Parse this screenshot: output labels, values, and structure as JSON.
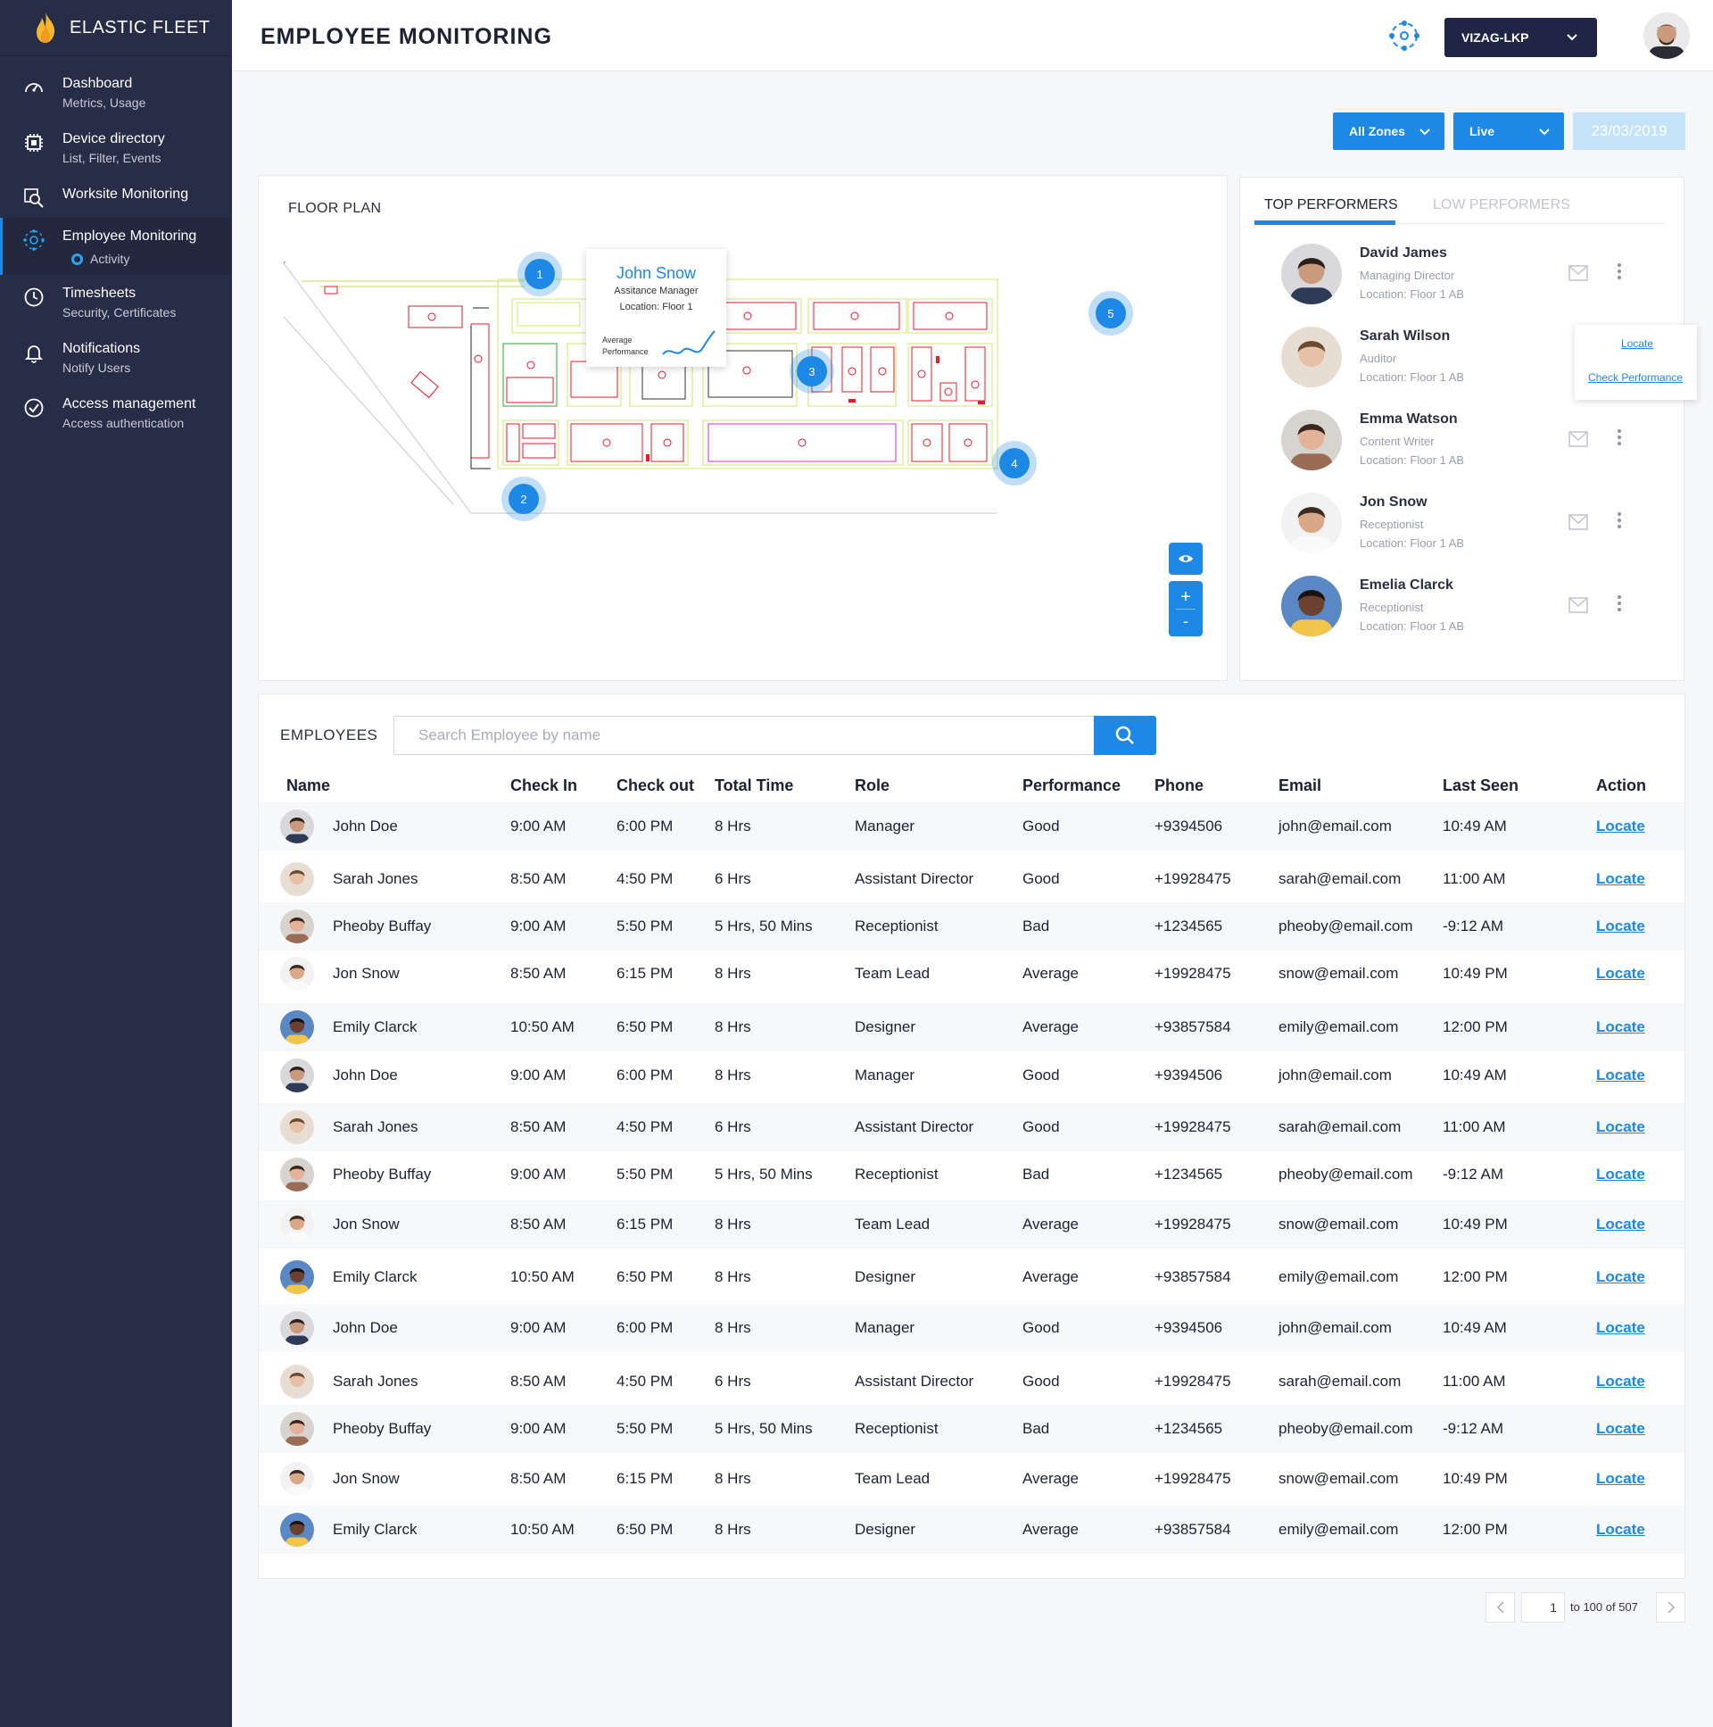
{
  "app": {
    "name": "ELASTIC FLEET"
  },
  "sidebar": {
    "items": [
      {
        "title": "Dashboard",
        "subtitle": "Metrics, Usage",
        "icon": "gauge-icon"
      },
      {
        "title": "Device directory",
        "subtitle": "List, Filter, Events",
        "icon": "chip-icon"
      },
      {
        "title": "Worksite Monitoring",
        "subtitle": "",
        "icon": "search-map-icon"
      },
      {
        "title": "Employee Monitoring",
        "subtitle": "",
        "icon": "network-icon",
        "active": true,
        "child": "Activity"
      },
      {
        "title": "Timesheets",
        "subtitle": "Security, Certificates",
        "icon": "clock-icon"
      },
      {
        "title": "Notifications",
        "subtitle": "Notify Users",
        "icon": "bell-icon"
      },
      {
        "title": "Access management",
        "subtitle": "Access authentication",
        "icon": "check-circle-icon"
      }
    ]
  },
  "header": {
    "title": "EMPLOYEE MONITORING",
    "site": "VIZAG-LKP"
  },
  "filters": {
    "zone": "All Zones",
    "mode": "Live",
    "date": "23/03/2019"
  },
  "floorplan": {
    "title": "FLOOR PLAN",
    "pins": [
      "1",
      "2",
      "3",
      "4",
      "5"
    ],
    "tooltip": {
      "name": "John Snow",
      "role": "Assitance Manager",
      "location": "Location: Floor 1",
      "metric_line1": "Average",
      "metric_line2": "Performance"
    },
    "controls": {
      "plus": "+",
      "minus": "-"
    }
  },
  "performers": {
    "tabs": [
      "TOP PERFORMERS",
      "LOW PERFORMERS"
    ],
    "items": [
      {
        "name": "David James",
        "role": "Managing Director",
        "location": "Location: Floor 1 AB"
      },
      {
        "name": "Sarah Wilson",
        "role": "Auditor",
        "location": "Location: Floor 1 AB"
      },
      {
        "name": "Emma Watson",
        "role": "Content Writer",
        "location": "Location: Floor 1 AB"
      },
      {
        "name": "Jon Snow",
        "role": "Receptionist",
        "location": "Location: Floor 1 AB"
      },
      {
        "name": "Emelia Clarck",
        "role": "Receptionist",
        "location": "Location: Floor 1 AB"
      }
    ],
    "menu": {
      "locate": "Locate",
      "check": "Check Performance"
    }
  },
  "employees": {
    "title": "EMPLOYEES",
    "search_placeholder": "Search Employee by name",
    "columns": [
      "Name",
      "Check In",
      "Check out",
      "Total Time",
      "Role",
      "Performance",
      "Phone",
      "Email",
      "Last Seen",
      "Action"
    ],
    "rows": [
      [
        "John Doe",
        "9:00 AM",
        "6:00 PM",
        "8 Hrs",
        "Manager",
        "Good",
        "+9394506",
        "john@email.com",
        "10:49 AM",
        "Locate"
      ],
      [
        "Sarah Jones",
        "8:50 AM",
        "4:50 PM",
        "6 Hrs",
        "Assistant Director",
        "Good",
        "+19928475",
        "sarah@email.com",
        "11:00 AM",
        "Locate"
      ],
      [
        "Pheoby Buffay",
        "9:00 AM",
        "5:50 PM",
        "5 Hrs, 50 Mins",
        "Receptionist",
        "Bad",
        "+1234565",
        "pheoby@email.com",
        "-9:12 AM",
        "Locate"
      ],
      [
        "Jon Snow",
        "8:50 AM",
        "6:15 PM",
        "8 Hrs",
        "Team Lead",
        "Average",
        "+19928475",
        "snow@email.com",
        "10:49 PM",
        "Locate"
      ],
      [
        "Emily Clarck",
        "10:50 AM",
        "6:50 PM",
        "8 Hrs",
        "Designer",
        "Average",
        "+93857584",
        "emily@email.com",
        "12:00  PM",
        "Locate"
      ],
      [
        "John Doe",
        "9:00 AM",
        "6:00 PM",
        "8 Hrs",
        "Manager",
        "Good",
        "+9394506",
        "john@email.com",
        "10:49 AM",
        "Locate"
      ],
      [
        "Sarah Jones",
        "8:50 AM",
        "4:50 PM",
        "6 Hrs",
        "Assistant Director",
        "Good",
        "+19928475",
        "sarah@email.com",
        "11:00 AM",
        "Locate"
      ],
      [
        "Pheoby Buffay",
        "9:00 AM",
        "5:50 PM",
        "5 Hrs, 50 Mins",
        "Receptionist",
        "Bad",
        "+1234565",
        "pheoby@email.com",
        "-9:12 AM",
        "Locate"
      ],
      [
        "Jon Snow",
        "8:50 AM",
        "6:15 PM",
        "8 Hrs",
        "Team Lead",
        "Average",
        "+19928475",
        "snow@email.com",
        "10:49 PM",
        "Locate"
      ],
      [
        "Emily Clarck",
        "10:50 AM",
        "6:50 PM",
        "8 Hrs",
        "Designer",
        "Average",
        "+93857584",
        "emily@email.com",
        "12:00  PM",
        "Locate"
      ],
      [
        "John Doe",
        "9:00 AM",
        "6:00 PM",
        "8 Hrs",
        "Manager",
        "Good",
        "+9394506",
        "john@email.com",
        "10:49 AM",
        "Locate"
      ],
      [
        "Sarah Jones",
        "8:50 AM",
        "4:50 PM",
        "6 Hrs",
        "Assistant Director",
        "Good",
        "+19928475",
        "sarah@email.com",
        "11:00 AM",
        "Locate"
      ],
      [
        "Pheoby Buffay",
        "9:00 AM",
        "5:50 PM",
        "5 Hrs, 50 Mins",
        "Receptionist",
        "Bad",
        "+1234565",
        "pheoby@email.com",
        "-9:12 AM",
        "Locate"
      ],
      [
        "Jon Snow",
        "8:50 AM",
        "6:15 PM",
        "8 Hrs",
        "Team Lead",
        "Average",
        "+19928475",
        "snow@email.com",
        "10:49 PM",
        "Locate"
      ],
      [
        "Emily Clarck",
        "10:50 AM",
        "6:50 PM",
        "8 Hrs",
        "Designer",
        "Average",
        "+93857584",
        "emily@email.com",
        "12:00  PM",
        "Locate"
      ]
    ]
  },
  "pagination": {
    "page": "1",
    "summary": "to 100 of 507"
  },
  "colors": {
    "accent": "#1e88e5",
    "sidebar": "#272c47",
    "site_select": "#202545",
    "date_bg": "#c4e3f9"
  }
}
